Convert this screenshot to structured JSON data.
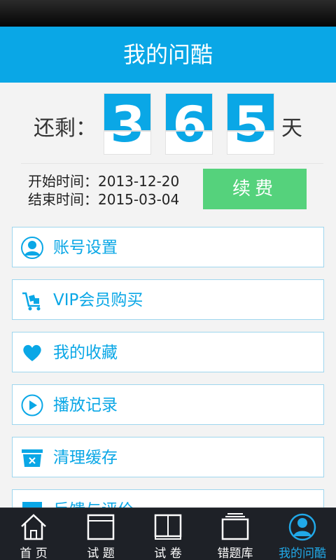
{
  "header": {
    "title": "我的问酷"
  },
  "countdown": {
    "prefix": "还剩：",
    "digits": [
      "3",
      "6",
      "5"
    ],
    "suffix": "天"
  },
  "membership": {
    "start_label": "开始时间：",
    "start_date": "2013-12-20",
    "end_label": "结束时间：",
    "end_date": "2015-03-04",
    "renew_label": "续费"
  },
  "menu": {
    "items": [
      {
        "label": "账号设置",
        "icon": "user-icon"
      },
      {
        "label": "VIP会员购买",
        "icon": "cart-icon"
      },
      {
        "label": "我的收藏",
        "icon": "heart-icon"
      },
      {
        "label": "播放记录",
        "icon": "play-icon"
      },
      {
        "label": "清理缓存",
        "icon": "clean-icon"
      },
      {
        "label": "反馈与评价",
        "icon": "feedback-icon"
      }
    ]
  },
  "tabbar": {
    "tabs": [
      {
        "label": "首 页",
        "icon": "home-icon"
      },
      {
        "label": "试 题",
        "icon": "questions-icon"
      },
      {
        "label": "试 卷",
        "icon": "paper-icon"
      },
      {
        "label": "错题库",
        "icon": "wrong-bank-icon"
      },
      {
        "label": "我的问酷",
        "icon": "profile-icon",
        "active": true
      }
    ]
  },
  "colors": {
    "accent": "#0aa7e6",
    "renew": "#55d27c",
    "tabbar_bg": "#1e2127"
  }
}
